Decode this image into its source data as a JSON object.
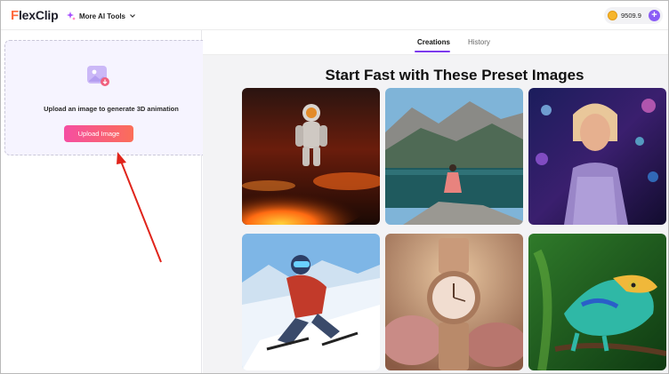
{
  "header": {
    "logo_f": "F",
    "logo_rest": "lexClip",
    "tools_label": "More AI Tools",
    "credits": "9509.9"
  },
  "left_panel": {
    "upload_hint": "Upload an image to generate 3D animation",
    "upload_button": "Upload Image"
  },
  "right_panel": {
    "tabs": [
      {
        "label": "Creations",
        "active": true
      },
      {
        "label": "History",
        "active": false
      }
    ],
    "title": "Start Fast with These Preset Images",
    "presets": [
      {
        "subject": "astronaut-on-lava"
      },
      {
        "subject": "woman-by-mountain-lake"
      },
      {
        "subject": "woman-neon-city"
      },
      {
        "subject": "skier-downhill"
      },
      {
        "subject": "rose-gold-watch"
      },
      {
        "subject": "chameleon-on-branch"
      }
    ]
  },
  "colors": {
    "accent": "#7c3aed",
    "upload_gradient_start": "#f54ea2",
    "upload_gradient_end": "#fb6e58",
    "annotation_arrow": "#e0241b"
  }
}
